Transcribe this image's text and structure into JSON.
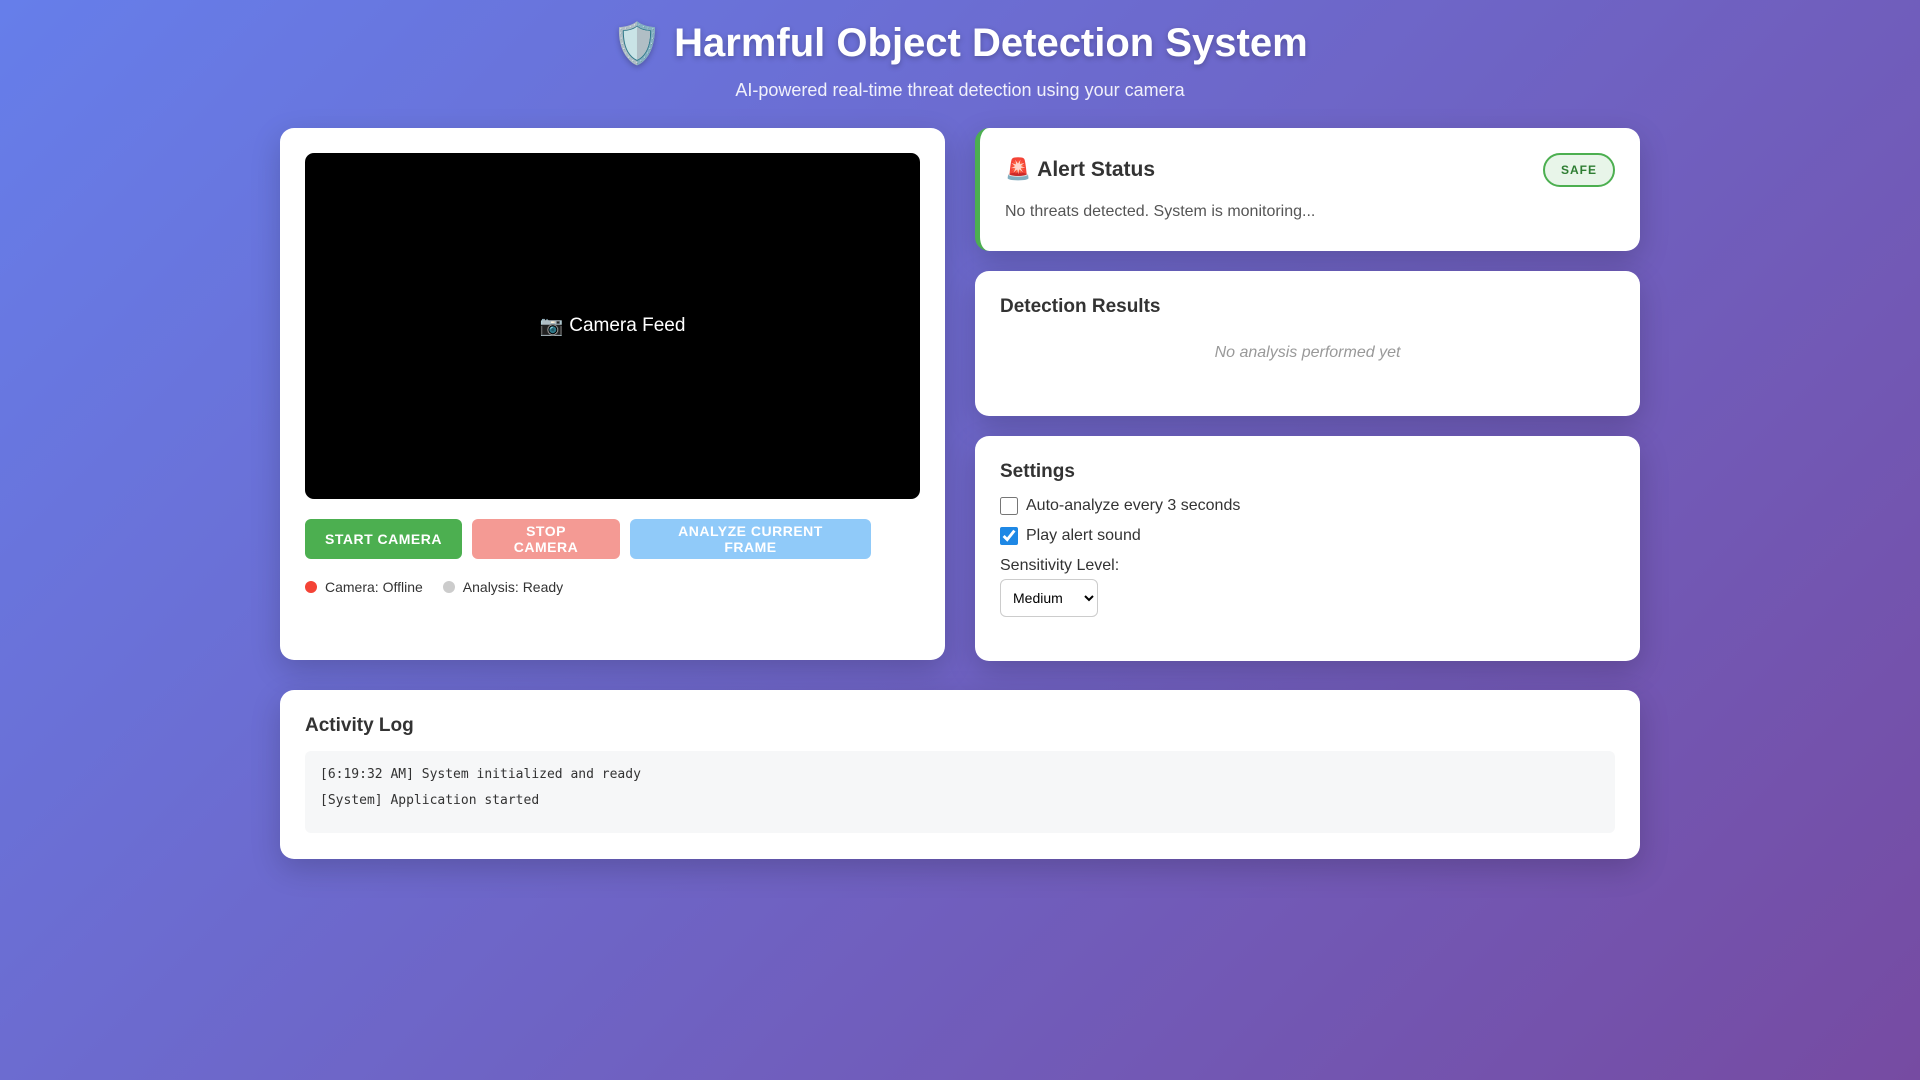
{
  "header": {
    "title_icon": "🛡️",
    "title": "Harmful Object Detection System",
    "subtitle": "AI-powered real-time threat detection using your camera"
  },
  "camera": {
    "icon": "📷",
    "label": "Camera Feed",
    "buttons": {
      "start": "START CAMERA",
      "stop": "STOP CAMERA",
      "analyze": "ANALYZE CURRENT FRAME"
    },
    "status": {
      "camera": "Camera: Offline",
      "analysis": "Analysis: Ready"
    }
  },
  "alert": {
    "icon": "🚨",
    "title": "Alert Status",
    "badge": "SAFE",
    "message": "No threats detected. System is monitoring..."
  },
  "results": {
    "title": "Detection Results",
    "empty": "No analysis performed yet"
  },
  "settings": {
    "title": "Settings",
    "auto_analyze": {
      "label": "Auto-analyze every 3 seconds",
      "checked": false
    },
    "alert_sound": {
      "label": "Play alert sound",
      "checked": true
    },
    "sensitivity_label": "Sensitivity Level:",
    "sensitivity_value": "Medium"
  },
  "log": {
    "title": "Activity Log",
    "lines": [
      "[6:19:32 AM] System initialized and ready",
      "[System] Application started"
    ]
  },
  "colors": {
    "safe": "#4caf50",
    "offline": "#f44336",
    "gradient_start": "#667eea",
    "gradient_end": "#764ba2"
  }
}
